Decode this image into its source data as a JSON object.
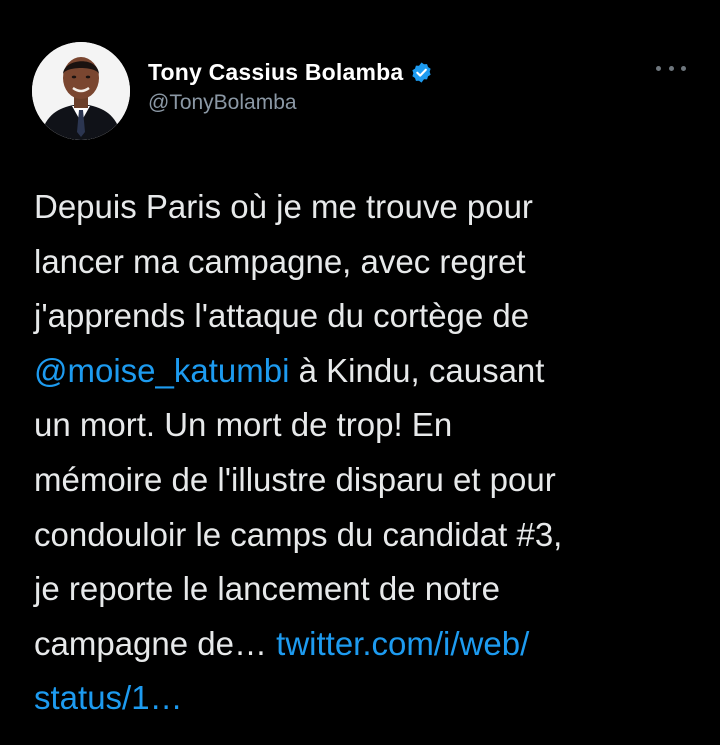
{
  "tweet": {
    "author": {
      "display_name": "Tony Cassius Bolamba",
      "handle": "@TonyBolamba",
      "verified": true,
      "avatar_icon": "profile-photo"
    },
    "more_icon": "more-horizontal-icon",
    "body": {
      "line1": "Depuis Paris où je me trouve pour",
      "line2": "lancer ma campagne, avec regret",
      "line3": "j'apprends l'attaque du cortège de",
      "line4_mention": "@moise_katumbi",
      "line4_rest": " à Kindu, causant",
      "line5": "un mort. Un mort de trop! En",
      "line6": "mémoire de l'illustre disparu et pour",
      "line7": "condouloir le camps du candidat #3,",
      "line8": "je reporte le lancement de notre",
      "line9_text": "campagne de… ",
      "line9_link": "twitter.com/i/web/",
      "line10_link": "status/1…"
    },
    "colors": {
      "background": "#000000",
      "text": "#e7e9ea",
      "secondary_text": "#8b98a5",
      "link": "#1d9bf0",
      "verified_badge": "#1d9bf0"
    }
  }
}
